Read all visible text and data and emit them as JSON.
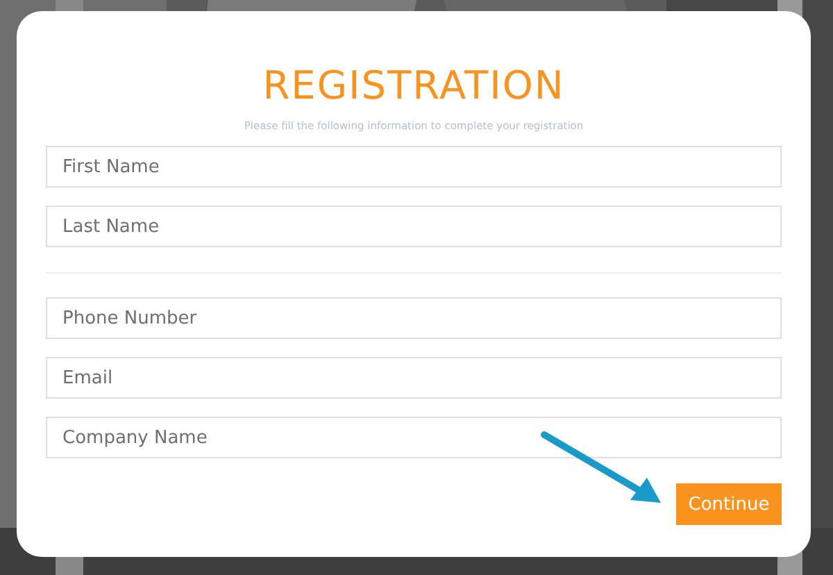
{
  "title": "REGISTRATION",
  "subtitle": "Please fill the following information to complete your registration",
  "field_groups": [
    {
      "fields": [
        {
          "placeholder": "First Name"
        },
        {
          "placeholder": "Last Name"
        }
      ]
    },
    {
      "fields": [
        {
          "placeholder": "Phone Number"
        },
        {
          "placeholder": "Email"
        },
        {
          "placeholder": "Company Name"
        }
      ]
    }
  ],
  "button": "Continue"
}
